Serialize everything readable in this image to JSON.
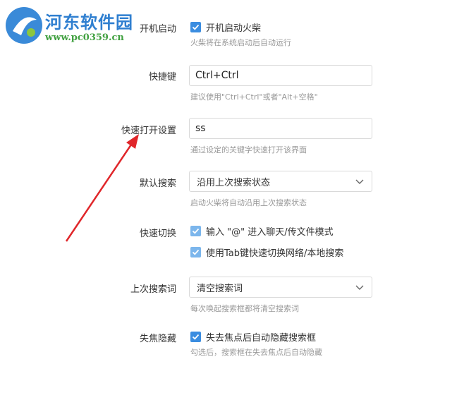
{
  "watermark": {
    "site_name": "河东软件园",
    "url": "www.pc0359.cn"
  },
  "settings": {
    "autostart": {
      "label": "开机启动",
      "checkbox_label": "开机启动火柴",
      "checked": true,
      "hint": "火柴将在系统启动后自动运行"
    },
    "hotkey": {
      "label": "快捷键",
      "value": "Ctrl+Ctrl",
      "hint": "建议使用\"Ctrl+Ctrl\"或者\"Alt+空格\""
    },
    "quick_open": {
      "label": "快速打开设置",
      "value": "ss",
      "hint": "通过设定的关键字快速打开该界面"
    },
    "default_search": {
      "label": "默认搜索",
      "selected": "沿用上次搜索状态",
      "hint": "启动火柴将自动沿用上次搜索状态"
    },
    "quick_switch": {
      "label": "快速切换",
      "options": [
        {
          "text": "输入 \"@\" 进入聊天/传文件模式",
          "checked": true
        },
        {
          "text": "使用Tab键快速切换网络/本地搜索",
          "checked": true
        }
      ]
    },
    "last_search": {
      "label": "上次搜索词",
      "selected": "清空搜索词",
      "hint": "每次唤起搜索框都将清空搜索词"
    },
    "blur_hide": {
      "label": "失焦隐藏",
      "checkbox_label": "失去焦点后自动隐藏搜索框",
      "checked": true,
      "hint": "勾选后，搜索框在失去焦点后自动隐藏"
    }
  },
  "colors": {
    "checkbox": "#3b8de0",
    "checkbox_light": "#7cb6ec",
    "arrow": "#e0262a"
  }
}
